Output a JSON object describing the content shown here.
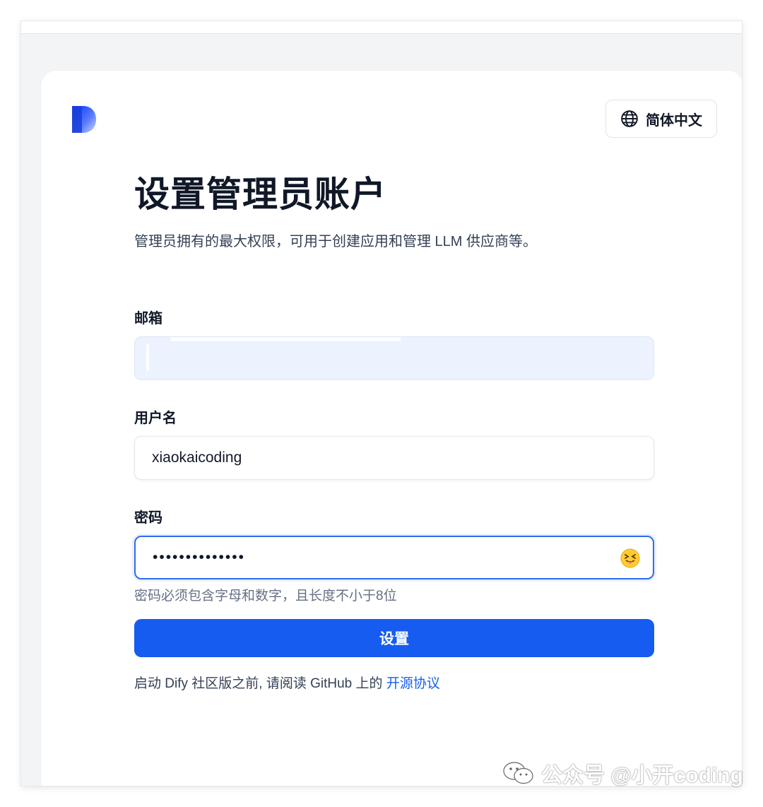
{
  "header": {
    "language_label": "简体中文"
  },
  "form": {
    "title": "设置管理员账户",
    "subtitle": "管理员拥有的最大权限，可用于创建应用和管理 LLM 供应商等。",
    "email_label": "邮箱",
    "email_value": "",
    "username_label": "用户名",
    "username_value": "xiaokaicoding",
    "password_label": "密码",
    "password_value": "••••••••••••••",
    "password_hint": "密码必须包含字母和数字，且长度不小于8位",
    "submit_label": "设置",
    "footer_prefix": "启动 Dify 社区版之前, 请阅读 GitHub 上的 ",
    "footer_link": "开源协议"
  },
  "watermark": {
    "text": "公众号 @小开coding"
  },
  "colors": {
    "primary": "#175cf0",
    "link": "#155eef",
    "email_bg": "#ecf2fe",
    "title": "#101828"
  },
  "icons": [
    "dify-logo-icon",
    "globe-icon",
    "squinting-face-tongue-icon",
    "wechat-icon"
  ]
}
